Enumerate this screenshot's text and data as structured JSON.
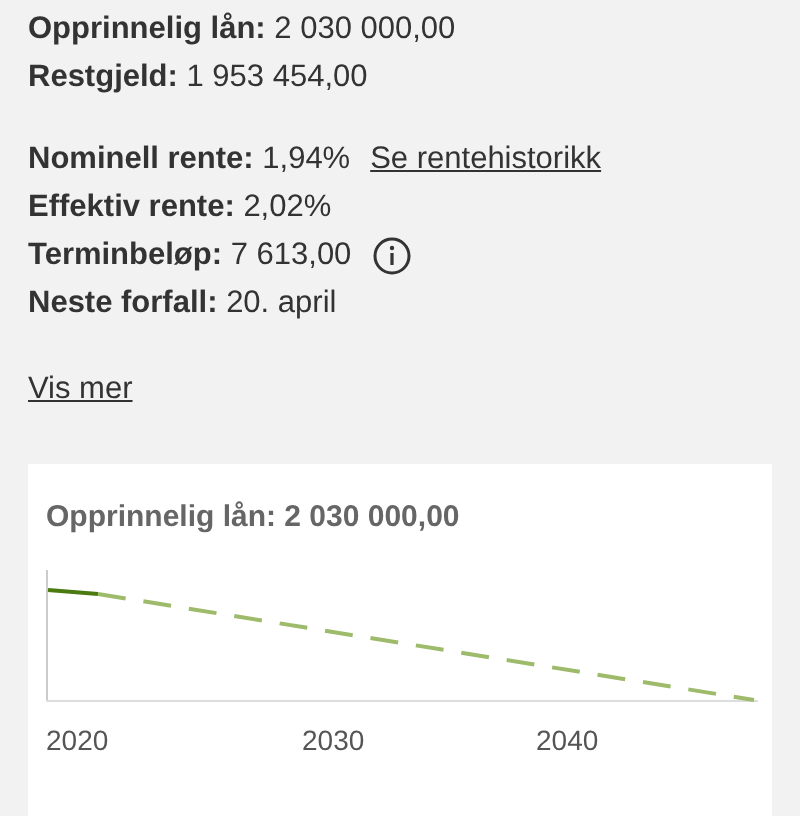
{
  "summary_groups": [
    [
      {
        "label": "Opprinnelig lån:",
        "value": "2 030 000,00",
        "info": false
      },
      {
        "label": "Restgjeld:",
        "value": "1 953 454,00",
        "info": false
      }
    ],
    [
      {
        "label": "Nominell rente:",
        "value": "1,94%",
        "link": "Se rentehistorikk",
        "info": false
      },
      {
        "label": "Effektiv rente:",
        "value": "2,02%",
        "info": false
      },
      {
        "label": "Terminbeløp:",
        "value": "7 613,00",
        "info": true
      },
      {
        "label": "Neste forfall:",
        "value": "20. april",
        "info": false
      }
    ]
  ],
  "more_link": "Vis mer",
  "chart_card": {
    "title": "Opprinnelig lån: 2 030 000,00",
    "x_labels": [
      "2020",
      "2030",
      "2040"
    ]
  }
}
